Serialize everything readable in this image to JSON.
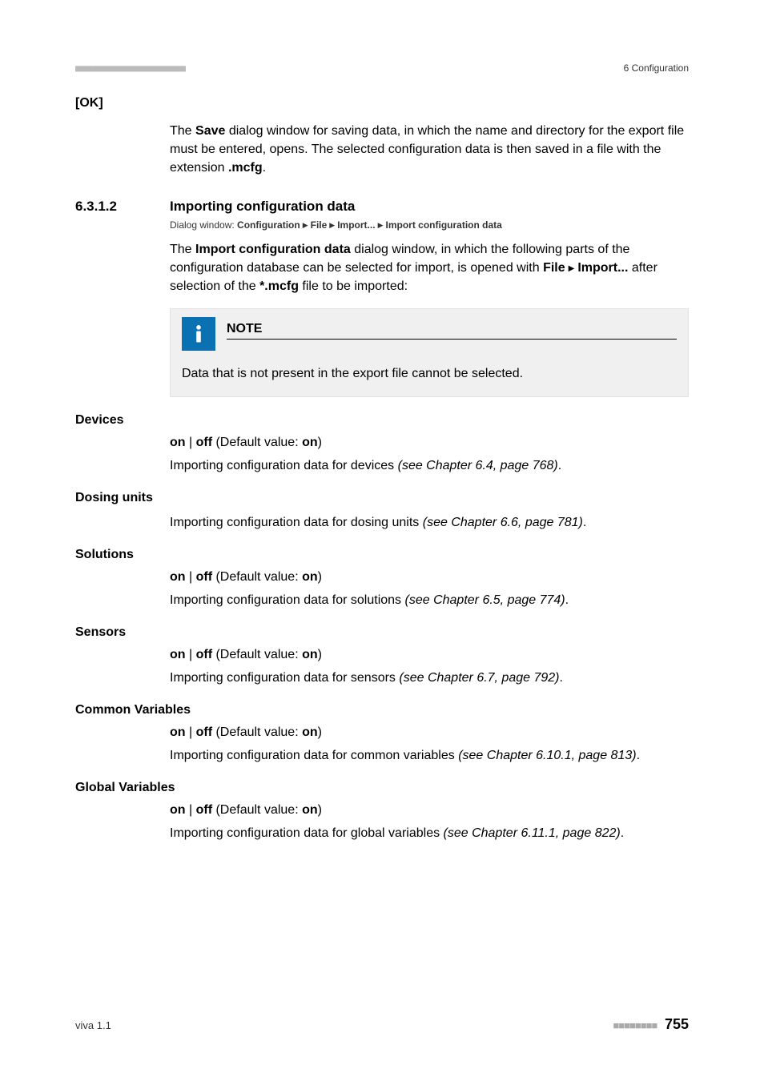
{
  "header": {
    "right": "6 Configuration"
  },
  "ok": {
    "label": "[OK]",
    "text_pre": "The ",
    "text_b1": "Save",
    "text_mid": " dialog window for saving data, in which the name and directory for the export file must be entered, opens. The selected configuration data is then saved in a file with the extension ",
    "text_b2": ".mcfg",
    "text_post": "."
  },
  "section": {
    "num": "6.3.1.2",
    "title": "Importing configuration data",
    "dialog_prefix": "Dialog window: ",
    "dl_1": "Configuration",
    "dl_2": "File",
    "dl_3": "Import...",
    "dl_4": "Import configuration data",
    "para_pre": "The ",
    "para_b1": "Import configuration data",
    "para_mid1": " dialog window, in which the following parts of the configuration database can be selected for import, is opened with ",
    "para_b2": "File",
    "para_b3": "Import...",
    "para_mid2": " after selection of the ",
    "para_b4": "*.mcfg",
    "para_post": " file to be imported:"
  },
  "note": {
    "title": "NOTE",
    "body": "Data that is not present in the export file cannot be selected."
  },
  "onoff": {
    "b_on": "on",
    "b_off": "off",
    "pre": " (Default value: ",
    "def": "on",
    "post": ")"
  },
  "fields": {
    "devices": {
      "label": "Devices",
      "desc": "Importing configuration data for devices ",
      "ref": "(see Chapter 6.4, page 768)"
    },
    "dosing": {
      "label": "Dosing units",
      "desc": "Importing configuration data for dosing units ",
      "ref": "(see Chapter 6.6, page 781)"
    },
    "solutions": {
      "label": "Solutions",
      "desc": "Importing configuration data for solutions ",
      "ref": "(see Chapter 6.5, page 774)"
    },
    "sensors": {
      "label": "Sensors",
      "desc": "Importing configuration data for sensors ",
      "ref": "(see Chapter 6.7, page 792)"
    },
    "common": {
      "label": "Common Variables",
      "desc": "Importing configuration data for common variables ",
      "ref": "(see Chapter 6.10.1, page 813)"
    },
    "global": {
      "label": "Global Variables",
      "desc": "Importing configuration data for global variables ",
      "ref": "(see Chapter 6.11.1, page 822)"
    }
  },
  "footer": {
    "left": "viva 1.1",
    "page": "755"
  }
}
